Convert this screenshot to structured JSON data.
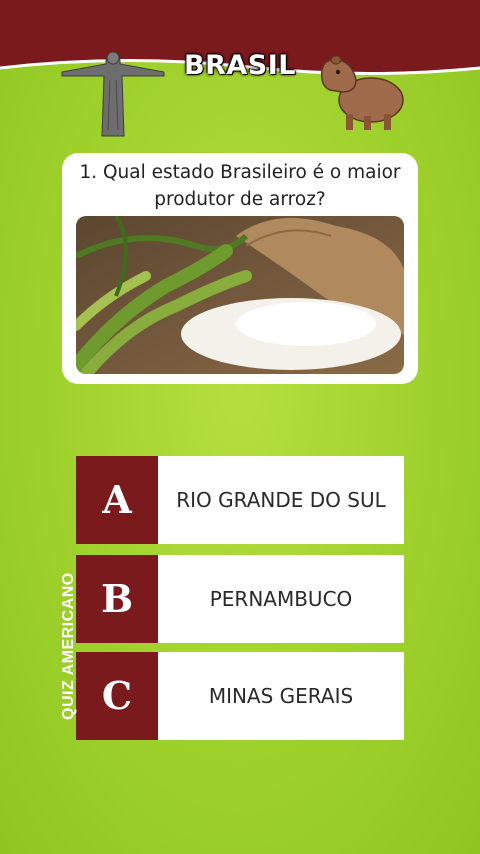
{
  "header": {
    "title": "BRASIL",
    "left_icon": "christ-the-redeemer-statue",
    "right_icon": "capybara"
  },
  "question": {
    "text": "1. Qual estado Brasileiro é o maior produtor de arroz?",
    "image": "rice-plant-and-sack-photo"
  },
  "answers": [
    {
      "letter": "A",
      "text": "RIO GRANDE DO SUL"
    },
    {
      "letter": "B",
      "text": "PERNAMBUCO"
    },
    {
      "letter": "C",
      "text": "MINAS GERAIS"
    }
  ],
  "side_label": "QUIZ AMERICANO",
  "colors": {
    "header_red": "#7b1a1d",
    "background_green": "#9fd12c",
    "letter_box": "#7b1a1d"
  }
}
